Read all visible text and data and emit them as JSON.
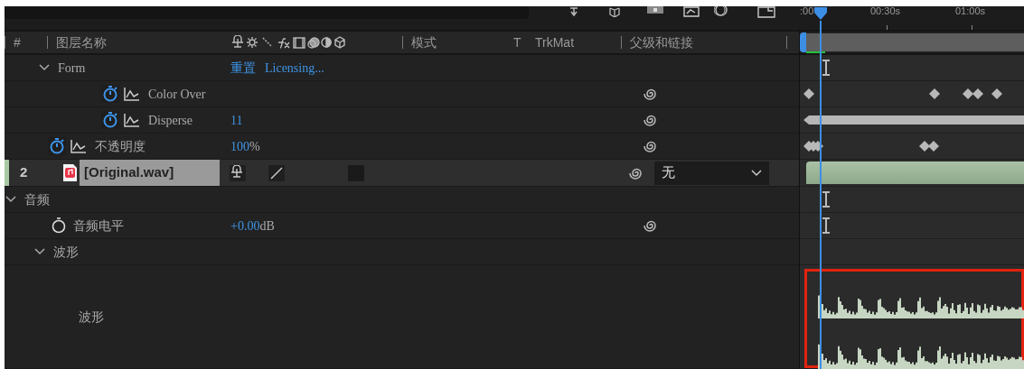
{
  "columns": [
    {
      "label": "#"
    },
    {
      "label": "图层名称"
    },
    {
      "label": "模式"
    },
    {
      "label": "T"
    },
    {
      "label": "TrkMat"
    },
    {
      "label": "父级和链接"
    }
  ],
  "ruler": [
    ":00",
    "00:30s",
    "01:00s"
  ],
  "rows": [
    {
      "kind": "group",
      "label": "Form",
      "expanded": true,
      "links": [
        "重置",
        "Licensing..."
      ],
      "children": [
        {
          "kind": "property",
          "label": "Color Over",
          "keyframed": true,
          "pick_whip": true
        },
        {
          "kind": "property",
          "label": "Disperse",
          "keyframed": true,
          "value": "11",
          "pick_whip": true
        }
      ]
    },
    {
      "kind": "property",
      "label": "不透明度",
      "keyframed": true,
      "value": "100",
      "unit": "%",
      "pick_whip": true
    },
    {
      "kind": "layer",
      "number": "2",
      "label": "[Original.wav]",
      "selected": true,
      "color": "#a9c9a4",
      "parent": "无",
      "pick_whip": true,
      "children": [
        {
          "kind": "group",
          "label": "音频",
          "expanded": true,
          "children": [
            {
              "kind": "property",
              "label": "音频电平",
              "keyframed": false,
              "value": "+0.00",
              "unit": "dB",
              "pick_whip": true
            },
            {
              "kind": "group",
              "label": "波形",
              "expanded": true,
              "children": [
                {
                  "kind": "waveform",
                  "label": "波形"
                }
              ]
            }
          ]
        }
      ]
    }
  ]
}
